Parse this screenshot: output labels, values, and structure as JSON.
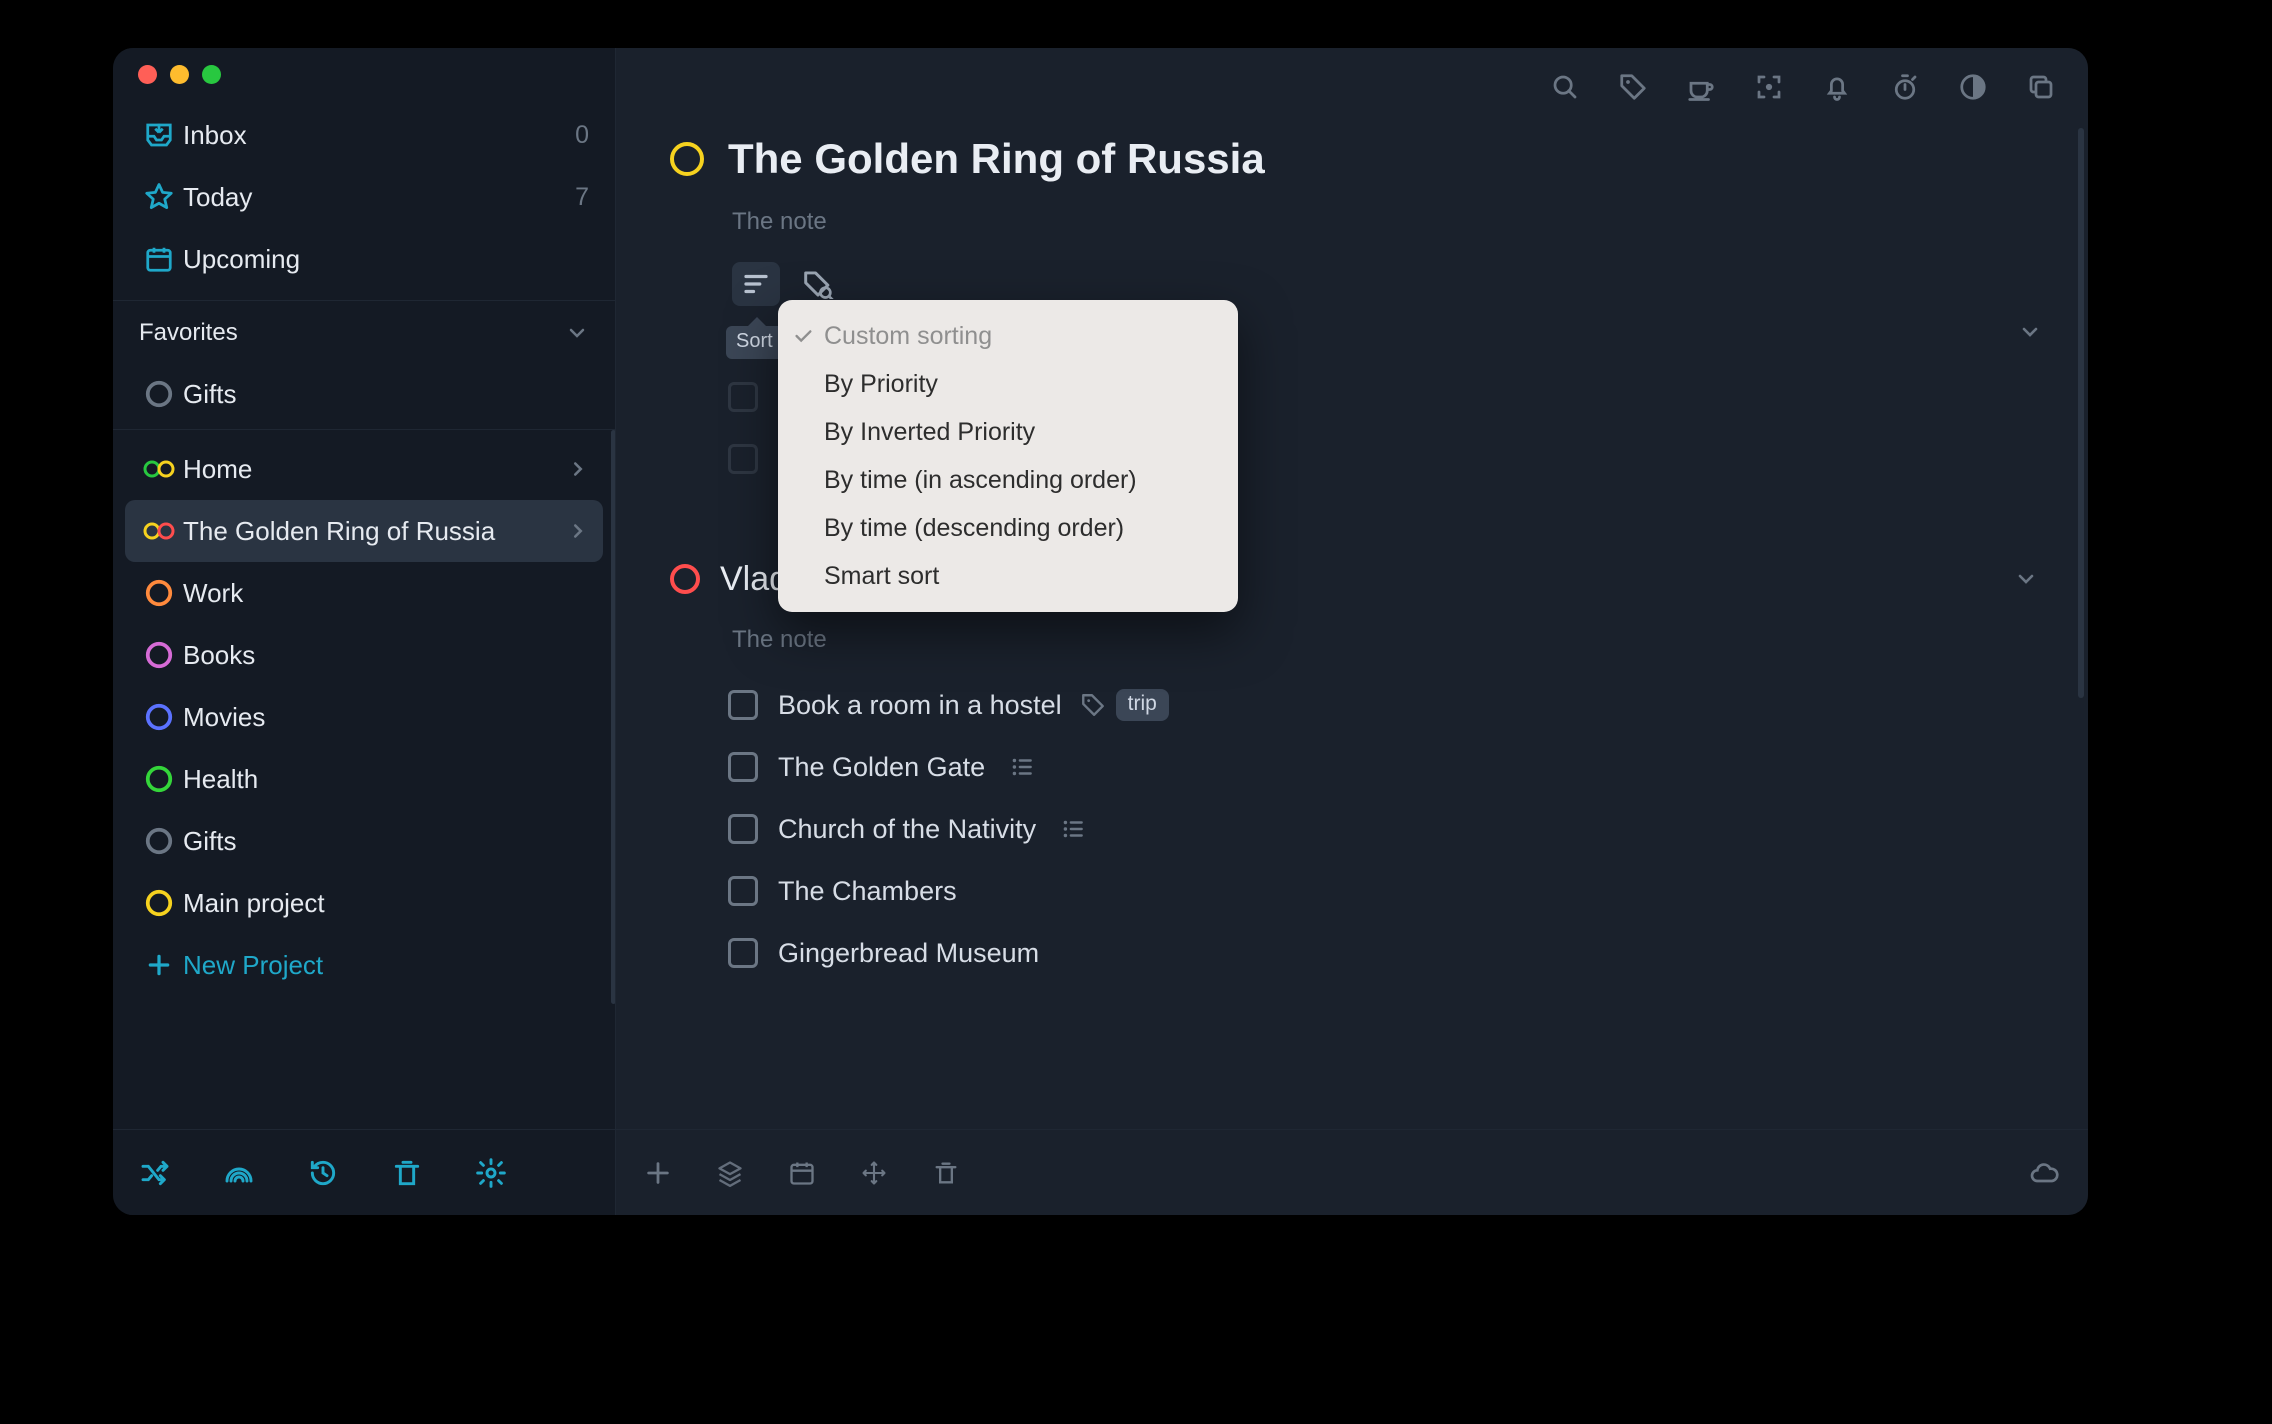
{
  "sidebar": {
    "nav": {
      "inbox": {
        "label": "Inbox",
        "count": "0"
      },
      "today": {
        "label": "Today",
        "count": "7"
      },
      "upcoming": {
        "label": "Upcoming"
      }
    },
    "favorites_header": "Favorites",
    "favorites": [
      {
        "label": "Gifts",
        "color": "#6b7684"
      }
    ],
    "projects": [
      {
        "label": "Home",
        "color1": "#28c840",
        "color2": "#f6d21f",
        "type": "goggles",
        "has_chev": true
      },
      {
        "label": "The Golden Ring of Russia",
        "color1": "#f6d21f",
        "color2": "#ff4d4d",
        "type": "goggles",
        "has_chev": true,
        "selected": true
      },
      {
        "label": "Work",
        "color": "#ff8a3d",
        "type": "ring"
      },
      {
        "label": "Books",
        "color": "#d66bd6",
        "type": "ring"
      },
      {
        "label": "Movies",
        "color": "#5b72ff",
        "type": "ring"
      },
      {
        "label": "Health",
        "color": "#34d63a",
        "type": "ring"
      },
      {
        "label": "Gifts",
        "color": "#6b7684",
        "type": "ring"
      },
      {
        "label": "Main project",
        "color": "#f6d21f",
        "type": "ring"
      }
    ],
    "new_project_label": "New Project"
  },
  "page": {
    "title": "The Golden Ring of Russia",
    "ring_color": "#f6d21f",
    "note_placeholder": "The note",
    "sort_tooltip": "Sort ty",
    "sort_options": [
      "Custom sorting",
      "By Priority",
      "By Inverted Priority",
      "By time (in ascending order)",
      "By time (descending order)",
      "Smart sort"
    ],
    "sections": [
      {
        "title": "Vladimir",
        "ring_color": "#ff4d4d",
        "note_placeholder": "The note",
        "tasks": [
          {
            "label": "Book a room in a hostel",
            "has_tag_icon": true,
            "tag": "trip"
          },
          {
            "label": "The Golden Gate",
            "has_sublist": true
          },
          {
            "label": "Church of the Nativity",
            "has_sublist": true
          },
          {
            "label": "The Chambers"
          },
          {
            "label": "Gingerbread Museum"
          }
        ]
      }
    ]
  }
}
